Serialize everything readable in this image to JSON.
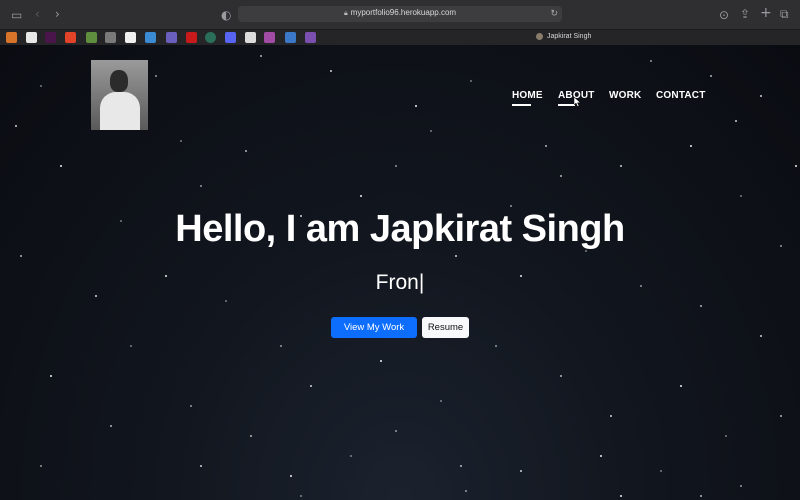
{
  "browser": {
    "url": "myportfolio96.herokuapp.com",
    "tab_title": "Japkirat Singh",
    "lock_icon": "lock-icon",
    "favorites": [
      "gmail",
      "amazon",
      "slack",
      "gitlab",
      "shopify",
      "bitbucket",
      "github",
      "linear",
      "bootstrap",
      "netflix",
      "chrome",
      "discord",
      "canva",
      "calendar",
      "jira",
      "notion"
    ]
  },
  "nav": {
    "items": [
      {
        "label": "HOME",
        "active": true
      },
      {
        "label": "ABOUT",
        "active": false,
        "hovered": true
      },
      {
        "label": "WORK",
        "active": false
      },
      {
        "label": "CONTACT",
        "active": false
      }
    ]
  },
  "hero": {
    "title": "Hello, I am Japkirat Singh",
    "typing_text": "Fron|",
    "primary_button": "View My Work",
    "secondary_button": "Resume"
  },
  "colors": {
    "background": "#0d1017",
    "primary": "#0d6efd",
    "text": "#ffffff"
  }
}
